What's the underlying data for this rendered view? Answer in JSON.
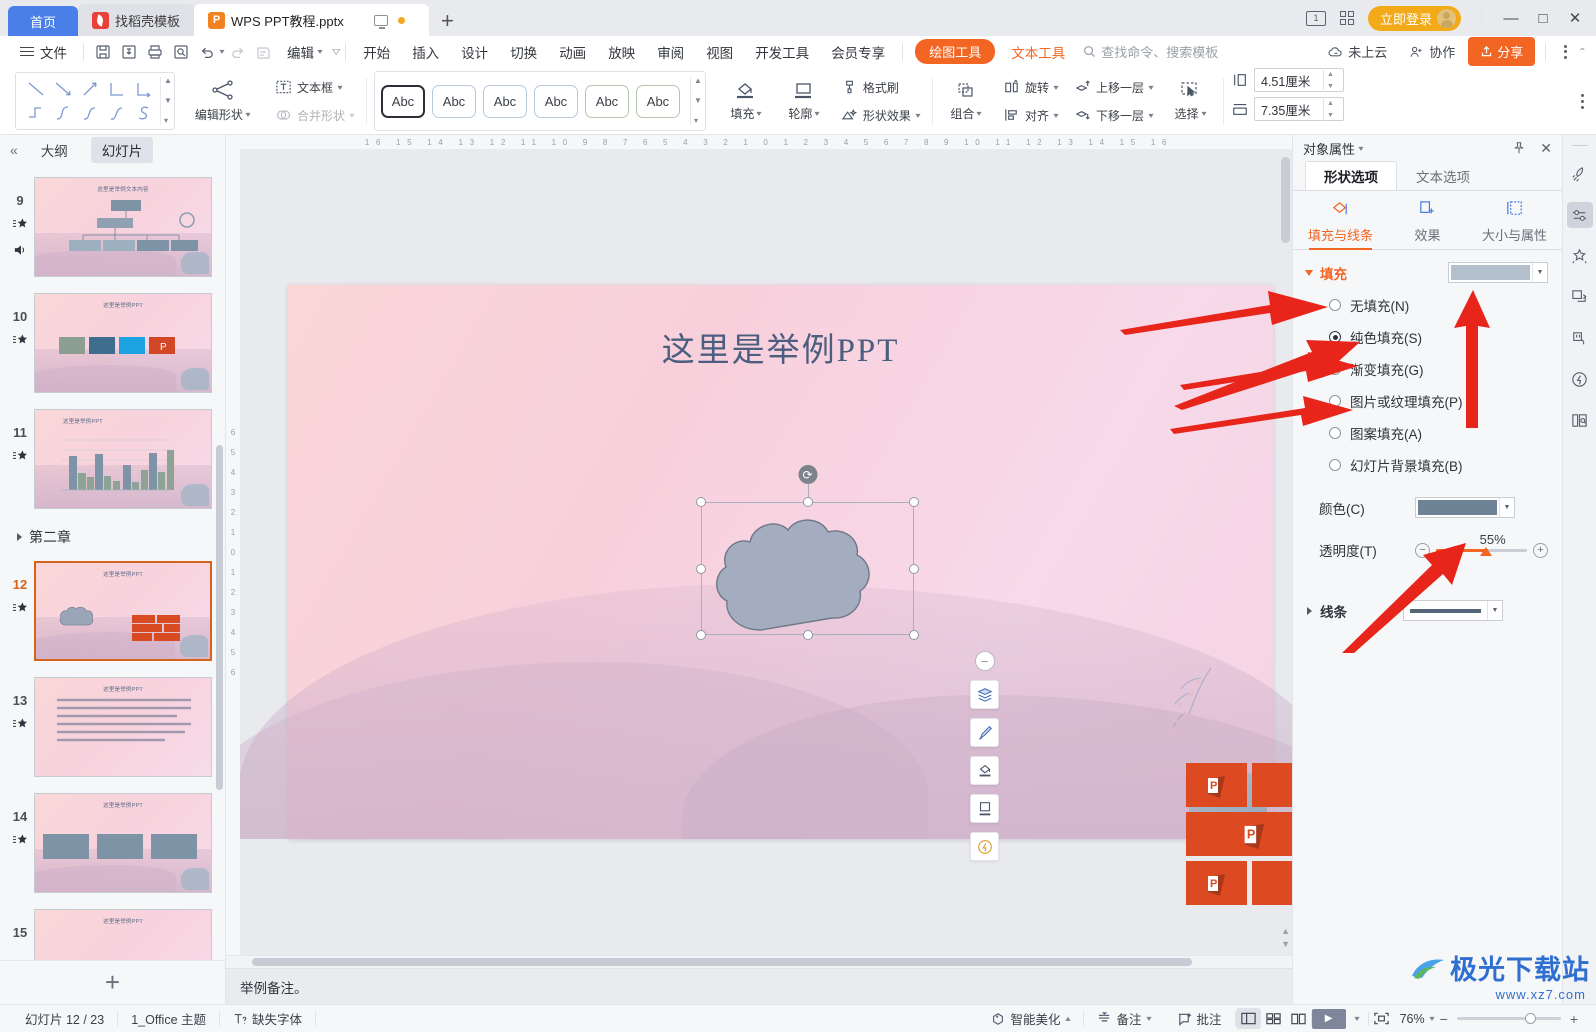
{
  "window": {
    "tabs": [
      {
        "label": "首页",
        "type": "home"
      },
      {
        "label": "找稻壳模板",
        "type": "mid",
        "icon": "docer-icon"
      },
      {
        "label": "WPS PPT教程.pptx",
        "type": "active",
        "icon": "ppt-file-icon"
      }
    ],
    "new_tab": "+",
    "page_count_badge": "1",
    "login_label": "立即登录",
    "minimize": "—",
    "maximize": "□",
    "close": "✕"
  },
  "menu": {
    "file_label": "文件",
    "quick_actions": [
      "save-icon",
      "save-as-cloud-icon",
      "print-icon",
      "print-preview-icon",
      "undo-icon",
      "redo-icon",
      "edit-lock-icon"
    ],
    "edit_label": "编辑",
    "items": [
      "开始",
      "插入",
      "设计",
      "切换",
      "动画",
      "放映",
      "审阅",
      "视图",
      "开发工具",
      "会员专享"
    ],
    "active_pill": "绘图工具",
    "text_tool": "文本工具",
    "search_placeholder": "查找命令、搜索模板",
    "cloud_status": "未上云",
    "collaborate": "协作",
    "share": "分享"
  },
  "ribbon": {
    "edit_shape": "编辑形状",
    "merge_shape": "合并形状",
    "text_box": "文本框",
    "fill": "填充",
    "outline": "轮廓",
    "shape_effect": "形状效果",
    "format_brush": "格式刷",
    "group": "组合",
    "align": "对齐",
    "rotate": "旋转",
    "bring_forward": "上移一层",
    "send_backward": "下移一层",
    "select": "选择",
    "style_sample": "Abc",
    "height_value": "4.51厘米",
    "width_value": "7.35厘米"
  },
  "slide_panel": {
    "collapse_icon": "collapse-left-icon",
    "tab_outline": "大纲",
    "tab_slides": "幻灯片",
    "chapter_label": "第二章",
    "slides": [
      {
        "num": "9",
        "title": "这里是举例文本内容",
        "kind": "org-chart"
      },
      {
        "num": "10",
        "title": "这里是举例PPT",
        "kind": "image-row"
      },
      {
        "num": "11",
        "title": "这里是举例PPT",
        "kind": "bar-chart"
      },
      {
        "num": "12",
        "title": "这里是举例PPT",
        "kind": "cloud-ppt",
        "current": true
      },
      {
        "num": "13",
        "title": "这里是举例PPT",
        "kind": "text-block"
      },
      {
        "num": "14",
        "title": "这里是举例PPT",
        "kind": "three-cards"
      },
      {
        "num": "15",
        "title": "这里是举例PPT",
        "kind": "diagram"
      }
    ],
    "add_slide": "+"
  },
  "canvas": {
    "slide_title": "这里是举例PPT",
    "ruler_h": "16 15 14 13 12 11 10 9 8 7 6 5 4 3 2 1 0 1 2 3 4 5 6 7 8 9 10 11 12 13 14 15 16",
    "ruler_v": "6 5 4 3 2 1 0 1 2 3 4 5 6",
    "float_tools": [
      "minus-icon",
      "layers-icon",
      "brush-icon",
      "fill-bucket-icon",
      "frame-icon",
      "lightbulb-icon"
    ],
    "rotate_handle": "rotate-icon",
    "shape_name": "cloud-shape"
  },
  "notes": {
    "text": "举例备注。"
  },
  "right_panel": {
    "title": "对象属性",
    "pin_icon": "pin-icon",
    "close_icon": "close-icon",
    "tabs": [
      {
        "label": "形状选项",
        "active": true
      },
      {
        "label": "文本选项",
        "active": false
      }
    ],
    "subtabs": [
      {
        "label": "填充与线条",
        "icon": "fill-line-icon",
        "active": true
      },
      {
        "label": "效果",
        "icon": "effects-icon",
        "active": false
      },
      {
        "label": "大小与属性",
        "icon": "size-props-icon",
        "active": false
      }
    ],
    "fill_section": {
      "title": "填充",
      "preview_color": "#b3bfcb",
      "options": [
        {
          "label": "无填充(N)",
          "selected": false
        },
        {
          "label": "纯色填充(S)",
          "selected": true
        },
        {
          "label": "渐变填充(G)",
          "selected": false
        },
        {
          "label": "图片或纹理填充(P)",
          "selected": false
        },
        {
          "label": "图案填充(A)",
          "selected": false
        },
        {
          "label": "幻灯片背景填充(B)",
          "selected": false
        }
      ],
      "color_label": "颜色(C)",
      "color_value": "#6e8395",
      "transparency_label": "透明度(T)",
      "transparency_value": "55%",
      "transparency_pct": 55
    },
    "line_section": {
      "title": "线条",
      "preview_color": "#54657a"
    }
  },
  "icon_rail": [
    "rocket-icon",
    "sliders-icon",
    "magic-star-icon",
    "export-icon",
    "hand-pen-icon",
    "lightning-shield-icon",
    "book-search-icon"
  ],
  "status_bar": {
    "slide_counter": "幻灯片 12 / 23",
    "theme": "1_Office 主题",
    "font_warning": "缺失字体",
    "beautify": "智能美化",
    "notes_btn": "备注",
    "comment_btn": "批注",
    "views": [
      "normal-view-icon",
      "sorter-view-icon",
      "reading-view-icon"
    ],
    "play": "play-icon",
    "fit_icon": "fit-screen-icon",
    "zoom": "76%",
    "zoom_minus": "−",
    "zoom_plus": "+"
  },
  "watermark": {
    "main": "极光下载站",
    "sub": "www.xz7.com"
  },
  "colors": {
    "accent_orange": "#f26522",
    "accent_blue": "#4a7ee8",
    "ppt_red": "#dd4a22",
    "login_amber": "#f2aa18",
    "annotation_red": "#e8251b"
  }
}
